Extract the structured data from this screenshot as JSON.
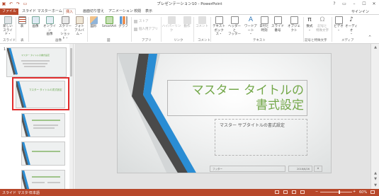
{
  "titlebar": {
    "title": "プレゼンテーション10 - PowerPoint",
    "qat": [
      "save-icon",
      "undo-icon",
      "redo-icon",
      "slideshow-icon"
    ],
    "window_buttons": [
      "?",
      "▭",
      "–",
      "☐",
      "✕"
    ]
  },
  "tabs": [
    {
      "label": "ファイル",
      "kind": "file"
    },
    {
      "label": "スライド マスター"
    },
    {
      "label": "ホーム"
    },
    {
      "label": "挿入",
      "active": true
    },
    {
      "label": "画面切り替え"
    },
    {
      "label": "アニメーション"
    },
    {
      "label": "校閲"
    },
    {
      "label": "表示"
    }
  ],
  "signin": "サインイン",
  "ribbon": {
    "buttons": {
      "new_slide": "新しい\nスライド・",
      "table": "表",
      "image": "画像",
      "online_image": "オンライン\n画像",
      "screenshot": "スクリーン\nショット・",
      "photo_album": "フォト\nアルバム・",
      "shapes": "図形",
      "smartart": "SmartArt",
      "chart": "グラフ",
      "store": "ストア",
      "my_apps": "個人用アプリ",
      "hyperlink": "ハイパーリンク",
      "action": "動作",
      "comment": "コメント",
      "textbox": "テキスト\nボックス・",
      "header_footer": "ヘッダーと\nフッター",
      "wordart": "ワードアート\n・",
      "date_time": "日付と\n時刻",
      "slide_number": "スライド番号",
      "object": "オブジェクト",
      "equation": "数式\n・",
      "symbol": "記号と\n特殊文字",
      "video": "ビデオ\n・",
      "audio": "オーディオ\n・"
    },
    "groups": {
      "slides": "スライド",
      "tables": "表",
      "images": "画像",
      "illustrations": "図",
      "apps": "アプリ",
      "links": "リンク",
      "comments": "コメント",
      "text": "テキスト",
      "symbols": "記号と特殊文字",
      "media": "メディア"
    }
  },
  "thumbnails": {
    "number": "1",
    "master_title": "マスター タイトルの書式設定",
    "layout_title": "マスター タイトルの書式設定"
  },
  "slide": {
    "title": "マスター タイトルの\n書式設定",
    "subtitle": "マスター サブタイトルの書式設定",
    "footer": "フッター",
    "date": "2016/6/26",
    "page": "#"
  },
  "status": {
    "view": "スライド マスター",
    "language": "日本語",
    "zoom": "60%",
    "zoom_minus": "−",
    "zoom_plus": "+"
  },
  "colors": {
    "accent": "#b7472a",
    "title_green": "#74a84a",
    "shard_blue": "#2a8dd4",
    "shard_dark": "#555555",
    "selection_red": "#e12d2d"
  }
}
